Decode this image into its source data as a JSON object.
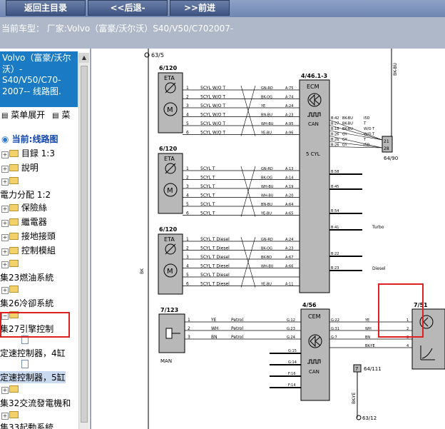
{
  "toolbar": {
    "home_label": "返回主目录",
    "back_label": "<<后退-",
    "forward_label": ">>前进"
  },
  "status": {
    "text": "当前车型： 厂家:Volvo（富豪/沃尔沃）S40/V50/C702007-"
  },
  "sidebar": {
    "title": "Volvo（富豪/沃尔沃）- S40/V50/C70-2007-- 线路图.",
    "expand_label": "菜单展开",
    "collapse_label": "菜",
    "current_label": "当前:线路图",
    "items": [
      {
        "label": "目録 1:3"
      },
      {
        "label": "說明"
      },
      {
        "label": ""
      },
      {
        "label": "電力分配 1:2"
      },
      {
        "label": "保險絲"
      },
      {
        "label": "繼電器"
      },
      {
        "label": "接地接頭"
      },
      {
        "label": "控制模組"
      },
      {
        "label": ""
      },
      {
        "label": "集23燃油系統"
      },
      {
        "label": ""
      },
      {
        "label": "集26冷卻系統"
      },
      {
        "label": ""
      },
      {
        "label": "集27引擎控制"
      },
      {
        "label": "定速控制器，4缸"
      },
      {
        "label": "定速控制器，5缸"
      },
      {
        "label": ""
      },
      {
        "label": "集32交流發電機和"
      },
      {
        "label": ""
      },
      {
        "label": "集33起動系統"
      }
    ]
  },
  "diagram": {
    "refs": {
      "r1": "63/5",
      "r2": "6/120",
      "r3": "6/120",
      "r4": "6/120",
      "r5": "4/46.1-3",
      "r6": "7/123",
      "r7": "4/56",
      "r8": "7/51",
      "r9": "64/90",
      "r10": "7",
      "r11": "64/111",
      "r12": "63/12",
      "r13": "BK-BU"
    },
    "eta": "ETA",
    "m": "M",
    "ecm": "ECM",
    "can": "CAN",
    "five_cyl": "5 CYL",
    "cem": "CEM",
    "man": "MAN",
    "bk": "BK",
    "turbo": "Turbo",
    "diesel": "Diesel",
    "g1_wires": [
      {
        "pin": "1",
        "sig": "5CYL W/O T",
        "col": "GN-RD",
        "term": "A:75"
      },
      {
        "pin": "2",
        "sig": "5CYL W/O T",
        "col": "BK-OG",
        "term": "A:74"
      },
      {
        "pin": "3",
        "sig": "5CYL W/O T",
        "col": "YE",
        "term": "A:24"
      },
      {
        "pin": "4",
        "sig": "5CYL W/O T",
        "col": "BN-BU",
        "term": "A:23"
      },
      {
        "pin": "5",
        "sig": "5CYL W/O T",
        "col": "WH-BU",
        "term": "A:95"
      },
      {
        "pin": "6",
        "sig": "5CYL W/O T",
        "col": "YE-BU",
        "term": "A:96"
      }
    ],
    "g2_wires": [
      {
        "pin": "1",
        "sig": "5CYL T",
        "col": "GN-RD",
        "term": "A:13"
      },
      {
        "pin": "2",
        "sig": "5CYL T",
        "col": "BK-OG",
        "term": "A:14"
      },
      {
        "pin": "3",
        "sig": "5CYL T",
        "col": "WH-BU",
        "term": "A:19"
      },
      {
        "pin": "4",
        "sig": "5CYL T",
        "col": "WH-BU",
        "term": "A:20"
      },
      {
        "pin": "5",
        "sig": "5CYL T",
        "col": "BN-BU",
        "term": "A:64"
      },
      {
        "pin": "6",
        "sig": "5CYL T",
        "col": "YE-BU",
        "term": "A:65"
      }
    ],
    "g3_wires": [
      {
        "pin": "1",
        "sig": "5CYL T  Diesel",
        "col": "GN-RD",
        "term": "A:24"
      },
      {
        "pin": "2",
        "sig": "5CYL T  Diesel",
        "col": "BK-OG",
        "term": "A:23"
      },
      {
        "pin": "3",
        "sig": "5CYL T  Diesel",
        "col": "BK-BO",
        "term": "A:67"
      },
      {
        "pin": "4",
        "sig": "5CYL T  Diesel",
        "col": "WH-BU",
        "term": "A:66"
      },
      {
        "pin": "5",
        "sig": "5CYL T  Diesel",
        "col": "",
        "term": ""
      },
      {
        "pin": "6",
        "sig": "5CYL T  Diesel",
        "col": "YE-BU",
        "term": "A:11"
      }
    ],
    "ecm_right": [
      {
        "term": "B:42",
        "col": "BK-BU",
        "sig": "I5D"
      },
      {
        "term": "B:27",
        "col": "BK-BU",
        "sig": "T"
      },
      {
        "term": "B:18",
        "col": "BK-BU",
        "sig": "W/O T"
      },
      {
        "term": "B:26",
        "col": "GY",
        "sig": "W/O T"
      },
      {
        "term": "B:26",
        "col": "GY",
        "sig": "T"
      },
      {
        "term": "B:26",
        "col": "GY",
        "sig": "I5D"
      }
    ],
    "conn_pins": [
      "21",
      "28"
    ],
    "b_terms": [
      "B:58",
      "B:45",
      "B:54",
      "B:41",
      "B:22",
      "B:23"
    ],
    "g4_wires": [
      {
        "pin": "1",
        "col": "YE",
        "sig": "Petrol",
        "term": "G:12"
      },
      {
        "pin": "2",
        "col": "WH",
        "sig": "Petrol",
        "term": "G:23"
      },
      {
        "pin": "3",
        "col": "BN",
        "sig": "Petrol",
        "term": "G:24"
      }
    ],
    "cem_right": [
      {
        "term": "G:22",
        "col": "YE",
        "pin": "1"
      },
      {
        "term": "G:31",
        "col": "WH",
        "pin": "2"
      },
      {
        "term": "G:7",
        "col": "BN",
        "pin": "3"
      },
      {
        "term": "",
        "col": "BK-YE",
        "pin": "4"
      }
    ],
    "cem_left": [
      "G:15",
      "G:14",
      "F:16",
      "F:14"
    ],
    "bottom_col": "BK-YE"
  }
}
